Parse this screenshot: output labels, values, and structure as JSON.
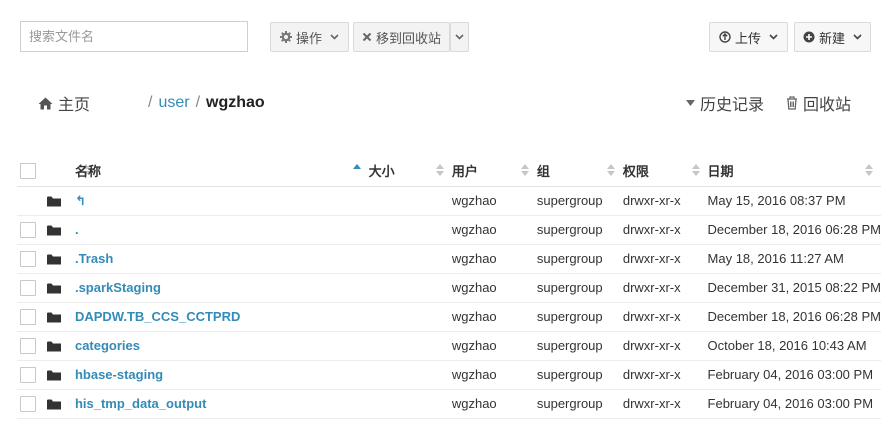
{
  "toolbar": {
    "search_placeholder": "搜索文件名",
    "actions_label": "操作",
    "move_to_trash_label": "移到回收站",
    "upload_label": "上传",
    "new_label": "新建"
  },
  "breadcrumb": {
    "home_label": "主页",
    "separator": "/",
    "user_segment": "user",
    "current": "wgzhao"
  },
  "links": {
    "history_label": "历史记录",
    "trash_label": "回收站"
  },
  "table": {
    "columns": {
      "name": "名称",
      "size": "大小",
      "user": "用户",
      "group": "组",
      "permissions": "权限",
      "date": "日期"
    },
    "rows": [
      {
        "name": "↰",
        "user": "wgzhao",
        "group": "supergroup",
        "permissions": "drwxr-xr-x",
        "date": "May 15, 2016 08:37 PM"
      },
      {
        "name": ".",
        "user": "wgzhao",
        "group": "supergroup",
        "permissions": "drwxr-xr-x",
        "date": "December 18, 2016 06:28 PM"
      },
      {
        "name": ".Trash",
        "user": "wgzhao",
        "group": "supergroup",
        "permissions": "drwxr-xr-x",
        "date": "May 18, 2016 11:27 AM"
      },
      {
        "name": ".sparkStaging",
        "user": "wgzhao",
        "group": "supergroup",
        "permissions": "drwxr-xr-x",
        "date": "December 31, 2015 08:22 PM"
      },
      {
        "name": "DAPDW.TB_CCS_CCTPRD",
        "user": "wgzhao",
        "group": "supergroup",
        "permissions": "drwxr-xr-x",
        "date": "December 18, 2016 06:28 PM"
      },
      {
        "name": "categories",
        "user": "wgzhao",
        "group": "supergroup",
        "permissions": "drwxr-xr-x",
        "date": "October 18, 2016 10:43 AM"
      },
      {
        "name": "hbase-staging",
        "user": "wgzhao",
        "group": "supergroup",
        "permissions": "drwxr-xr-x",
        "date": "February 04, 2016 03:00 PM"
      },
      {
        "name": "his_tmp_data_output",
        "user": "wgzhao",
        "group": "supergroup",
        "permissions": "drwxr-xr-x",
        "date": "February 04, 2016 03:00 PM"
      }
    ]
  },
  "colors": {
    "link": "#338bb8",
    "button_bg": "#f3f3f3",
    "border": "#dadada"
  }
}
